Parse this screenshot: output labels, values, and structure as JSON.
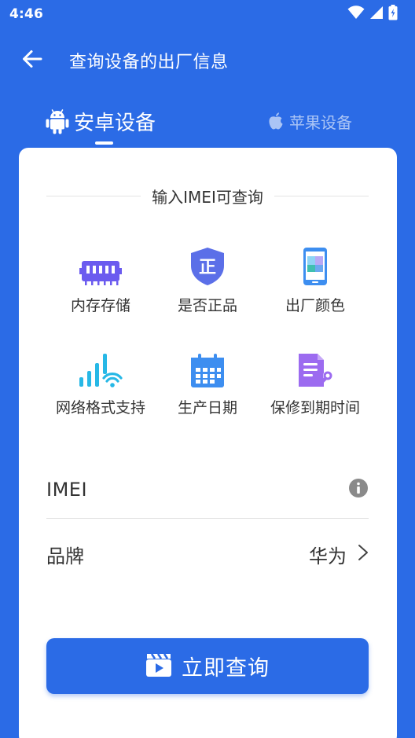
{
  "status_bar": {
    "time": "4:46"
  },
  "app_bar": {
    "title": "查询设备的出厂信息"
  },
  "tabs": [
    {
      "label": "安卓设备",
      "icon": "android-icon",
      "selected": true
    },
    {
      "label": "苹果设备",
      "icon": "apple-icon",
      "selected": false
    }
  ],
  "section": {
    "title": "输入IMEI可查询"
  },
  "features": [
    {
      "label": "内存存储",
      "icon": "memory-icon"
    },
    {
      "label": "是否正品",
      "icon": "genuine-shield-icon",
      "icon_text": "正"
    },
    {
      "label": "出厂颜色",
      "icon": "phone-color-icon"
    },
    {
      "label": "网络格式支持",
      "icon": "network-signal-icon"
    },
    {
      "label": "生产日期",
      "icon": "calendar-icon"
    },
    {
      "label": "保修到期时间",
      "icon": "warranty-document-icon"
    }
  ],
  "form": {
    "imei_label": "IMEI",
    "brand_label": "品牌",
    "brand_value": "华为",
    "brand_chevron": ">"
  },
  "query_button": {
    "label": "立即查询",
    "icon": "play-clapper-icon"
  },
  "colors": {
    "primary": "#2B6BE6",
    "memory": "#6B5BEF",
    "shield": "#5B6FE8",
    "network": "#27B8E6",
    "calendar": "#3D8EF0",
    "document": "#9C6BF0"
  }
}
